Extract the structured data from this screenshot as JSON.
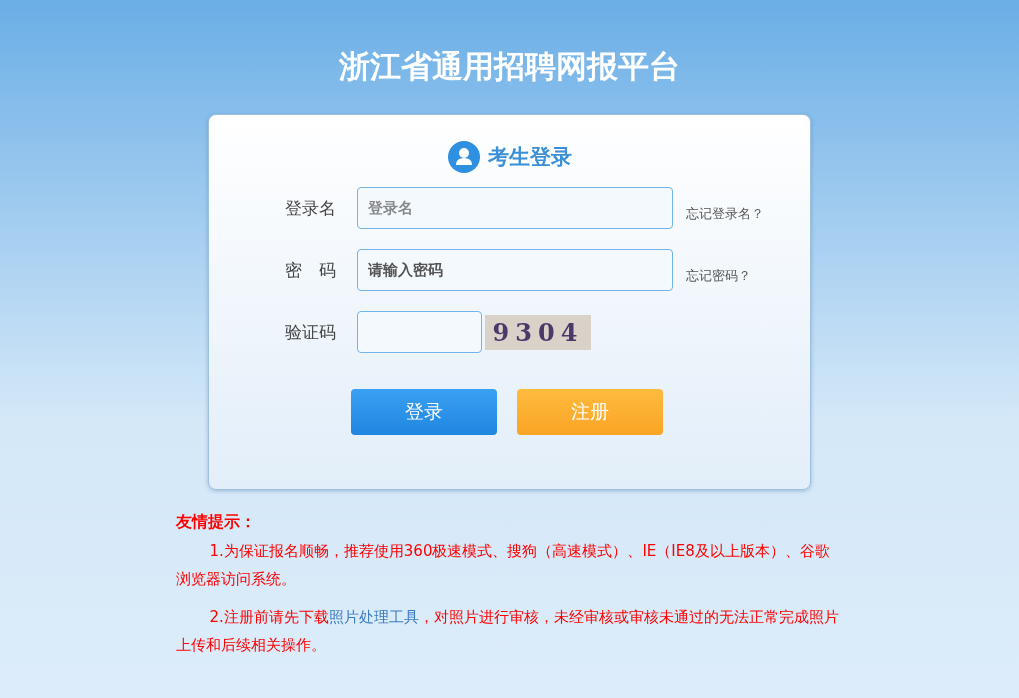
{
  "site_title": "浙江省通用招聘网报平台",
  "login_panel": {
    "heading": "考生登录",
    "fields": [
      {
        "label": "登录名",
        "placeholder": "登录名",
        "kind": "text",
        "link": "忘记登录名？"
      },
      {
        "label": "密　码",
        "placeholder": "请输入密码",
        "kind": "password",
        "link": "忘记密码？"
      },
      {
        "label": "验证码",
        "kind": "captcha",
        "captcha": "9304"
      }
    ],
    "buttons": [
      {
        "label": "登录",
        "kind": "primary"
      },
      {
        "label": "注册",
        "kind": "secondary"
      }
    ]
  },
  "notice": {
    "title": "友情提示：",
    "paragraphs": [
      {
        "text": "1.为保证报名顺畅，推荐使用360极速模式、搜狗（高速模式）、IE（IE8及以上版本）、谷歌浏览器访问系统。"
      },
      {
        "text": "2.注册前请先下载",
        "link": "照片处理工具",
        "after": "，对照片进行审核，未经审核或审核未通过的无法正常完成照片上传和后续相关操作。"
      }
    ]
  }
}
